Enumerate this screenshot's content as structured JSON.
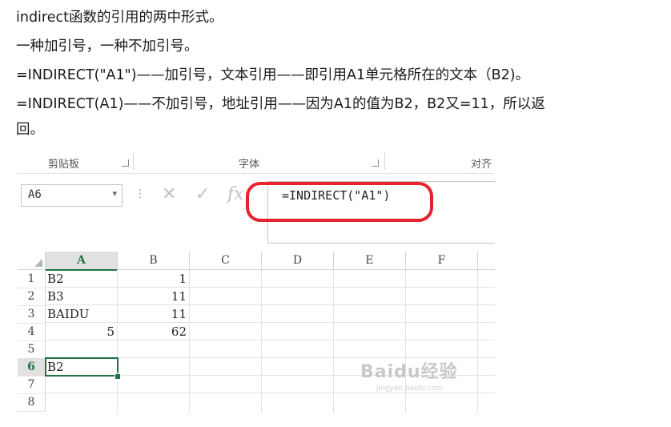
{
  "article": {
    "p1": "indirect函数的引用的两中形式。",
    "p2": "一种加引号，一种不加引号。",
    "p3": "=INDIRECT(\"A1\")——加引号，文本引用——即引用A1单元格所在的文本（B2)。",
    "p4": "=INDIRECT(A1)——不加引号，地址引用——因为A1的值为B2，B2又=11，所以返",
    "p5": "回。"
  },
  "ribbon": {
    "clipboard": "剪贴板",
    "font": "字体",
    "align": "对齐"
  },
  "formula_bar": {
    "name_box": "A6",
    "name_arrow": "▾",
    "cancel_glyph": "✕",
    "enter_glyph": "✓",
    "fx_glyph": "fx",
    "formula": "=INDIRECT(\"A1\")",
    "highlight_color": "#e8232e"
  },
  "sheet": {
    "columns": [
      "A",
      "B",
      "C",
      "D",
      "E",
      "F"
    ],
    "rows": [
      "1",
      "2",
      "3",
      "4",
      "5",
      "6",
      "7",
      "8"
    ],
    "cells": {
      "A1": "B2",
      "B1": "1",
      "A2": "B3",
      "B2": "11",
      "A3": "BAIDU",
      "B3": "11",
      "A4": "5",
      "B4": "62",
      "A6": "B2"
    },
    "active_cell": "A6",
    "accent_color": "#217346"
  },
  "watermark": {
    "brand": "Baidu经验",
    "url": "jingyan.baidu.com"
  }
}
